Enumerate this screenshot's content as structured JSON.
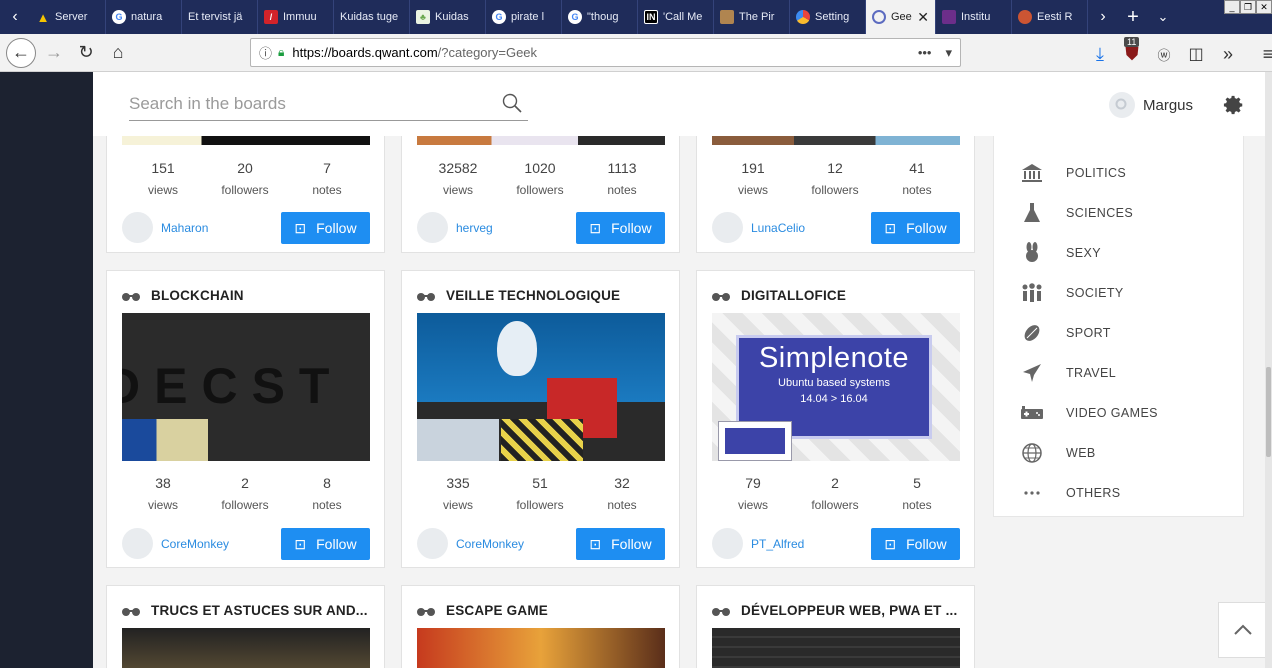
{
  "browser": {
    "tabs": [
      {
        "label": "Server",
        "icon": "warning-icon",
        "color": "#f5c400"
      },
      {
        "label": "natura",
        "icon": "google-icon",
        "color": "#ffffff"
      },
      {
        "label": "Et tervist jä",
        "icon": "",
        "color": ""
      },
      {
        "label": "Immuu",
        "icon": "red-logo-icon",
        "color": "#d2232a"
      },
      {
        "label": "Kuidas tuge",
        "icon": "",
        "color": ""
      },
      {
        "label": "Kuidas",
        "icon": "plant-icon",
        "color": "#6aa84f"
      },
      {
        "label": "pirate l",
        "icon": "google-icon",
        "color": "#ffffff"
      },
      {
        "label": "\"thoug",
        "icon": "google-icon",
        "color": "#ffffff"
      },
      {
        "label": "'Call Me",
        "icon": "in-icon",
        "color": "#000000"
      },
      {
        "label": "The Pir",
        "icon": "portrait-icon",
        "color": "#b08550"
      },
      {
        "label": "Setting",
        "icon": "chrome-icon",
        "color": "#e8453c"
      },
      {
        "label": "Gee",
        "icon": "qwant-icon",
        "color": "#5c6bc0",
        "active": true
      },
      {
        "label": "Institu",
        "icon": "purple-icon",
        "color": "#6c2e8a"
      },
      {
        "label": "Eesti R",
        "icon": "eesti-icon",
        "color": "#cc5533"
      }
    ],
    "url_host": "https://boards.qwant.com",
    "url_rest": "/?category=Geek",
    "badge_count": "11"
  },
  "header": {
    "search_placeholder": "Search in the boards",
    "user_name": "Margus"
  },
  "cards": [
    {
      "title": "",
      "views": "151",
      "followers": "20",
      "notes": "7",
      "owner": "Maharon",
      "follow": "Follow"
    },
    {
      "title": "",
      "views": "32582",
      "followers": "1020",
      "notes": "1113",
      "owner": "herveg",
      "follow": "Follow"
    },
    {
      "title": "",
      "views": "191",
      "followers": "12",
      "notes": "41",
      "owner": "LunaCelio",
      "follow": "Follow"
    },
    {
      "title": "BLOCKCHAIN",
      "views": "38",
      "followers": "2",
      "notes": "8",
      "owner": "CoreMonkey",
      "follow": "Follow",
      "thumb_text": "DECST"
    },
    {
      "title": "VEILLE TECHNOLOGIQUE",
      "views": "335",
      "followers": "51",
      "notes": "32",
      "owner": "CoreMonkey",
      "follow": "Follow"
    },
    {
      "title": "DIGITALLOFICE",
      "views": "79",
      "followers": "2",
      "notes": "5",
      "owner": "PT_Alfred",
      "follow": "Follow",
      "thumb_title": "Simplenote",
      "thumb_sub": "Ubuntu based systems",
      "thumb_ver": "14.04 > 16.04"
    },
    {
      "title": "TRUCS ET ASTUCES SUR AND..."
    },
    {
      "title": "ESCAPE GAME"
    },
    {
      "title": "DÉVELOPPEUR WEB, PWA ET ..."
    }
  ],
  "labels": {
    "views": "views",
    "followers": "followers",
    "notes": "notes"
  },
  "categories": [
    {
      "label": "POLITICS",
      "icon": "building-icon"
    },
    {
      "label": "SCIENCES",
      "icon": "flask-icon"
    },
    {
      "label": "SEXY",
      "icon": "bunny-icon"
    },
    {
      "label": "SOCIETY",
      "icon": "people-icon"
    },
    {
      "label": "SPORT",
      "icon": "ball-icon"
    },
    {
      "label": "TRAVEL",
      "icon": "plane-icon"
    },
    {
      "label": "VIDEO GAMES",
      "icon": "gamepad-icon"
    },
    {
      "label": "WEB",
      "icon": "globe-icon"
    },
    {
      "label": "OTHERS",
      "icon": "dots-icon"
    }
  ],
  "colors": {
    "accent": "#1e8ef2",
    "owner_link": "#2a8be0",
    "tabstrip": "#1f2c5a"
  }
}
